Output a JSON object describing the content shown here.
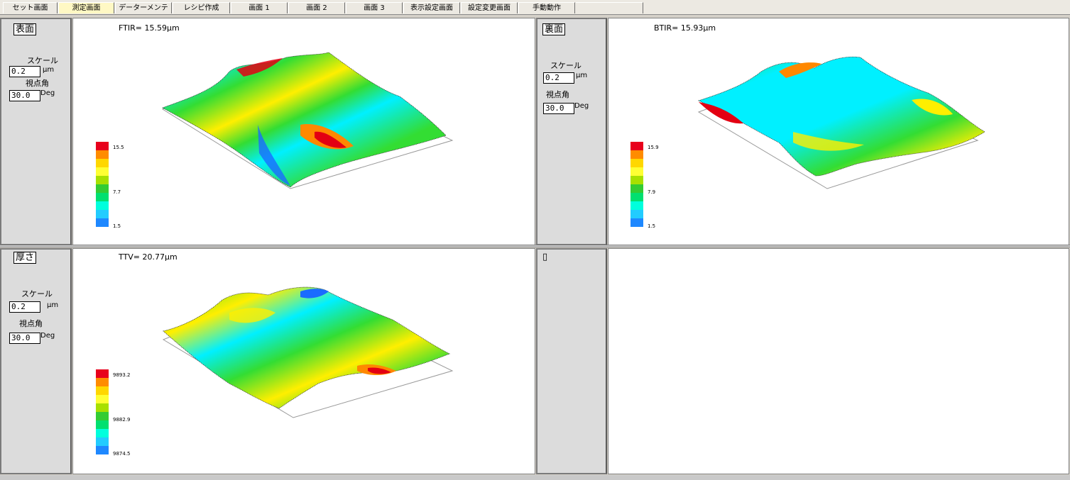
{
  "tabs": [
    {
      "label": "セット画面"
    },
    {
      "label": "測定画面",
      "active": true
    },
    {
      "label": "データーメンテ"
    },
    {
      "label": "レシピ作成"
    },
    {
      "label": "画面 1"
    },
    {
      "label": "画面 2"
    },
    {
      "label": "画面 3"
    },
    {
      "label": "表示設定画面"
    },
    {
      "label": "設定変更画面"
    },
    {
      "label": "手動動作"
    }
  ],
  "panels": {
    "front": {
      "title": "表面",
      "scale_label": "スケール",
      "scale_value": "0.2",
      "scale_unit": "μm",
      "angle_label": "視点角",
      "angle_value": "30.0",
      "angle_unit": "Deg",
      "measure": "FTIR= 15.59μm",
      "legend": {
        "max": "15.5",
        "mid": "7.7",
        "min": "1.5"
      }
    },
    "back": {
      "title": "裏面",
      "scale_label": "スケール",
      "scale_value": "0.2",
      "scale_unit": "μm",
      "angle_label": "視点角",
      "angle_value": "30.0",
      "angle_unit": "Deg",
      "measure": "BTIR= 15.93μm",
      "legend": {
        "max": "15.9",
        "mid": "7.9",
        "min": "1.5"
      }
    },
    "thickness": {
      "title": "厚さ",
      "scale_label": "スケール",
      "scale_value": "0.2",
      "scale_unit": "μm",
      "angle_label": "視点角",
      "angle_value": "30.0",
      "angle_unit": "Deg",
      "measure": "TTV= 20.77μm",
      "legend": {
        "max": "9893.2",
        "mid": "9882.9",
        "min": "9874.5"
      }
    },
    "empty": {
      "title": "▯"
    }
  },
  "legend_colors": [
    "#e8001c",
    "#ff8c00",
    "#ffd700",
    "#ffff33",
    "#a8e000",
    "#33cc33",
    "#00e070",
    "#00ffdd",
    "#22ccff",
    "#1e88ff"
  ],
  "surface_colors": {
    "blue": "#1a6bff",
    "cyan": "#00f0ff",
    "green": "#33dd33",
    "yellow": "#ffef00",
    "orange": "#ff8800",
    "red": "#e30012"
  }
}
